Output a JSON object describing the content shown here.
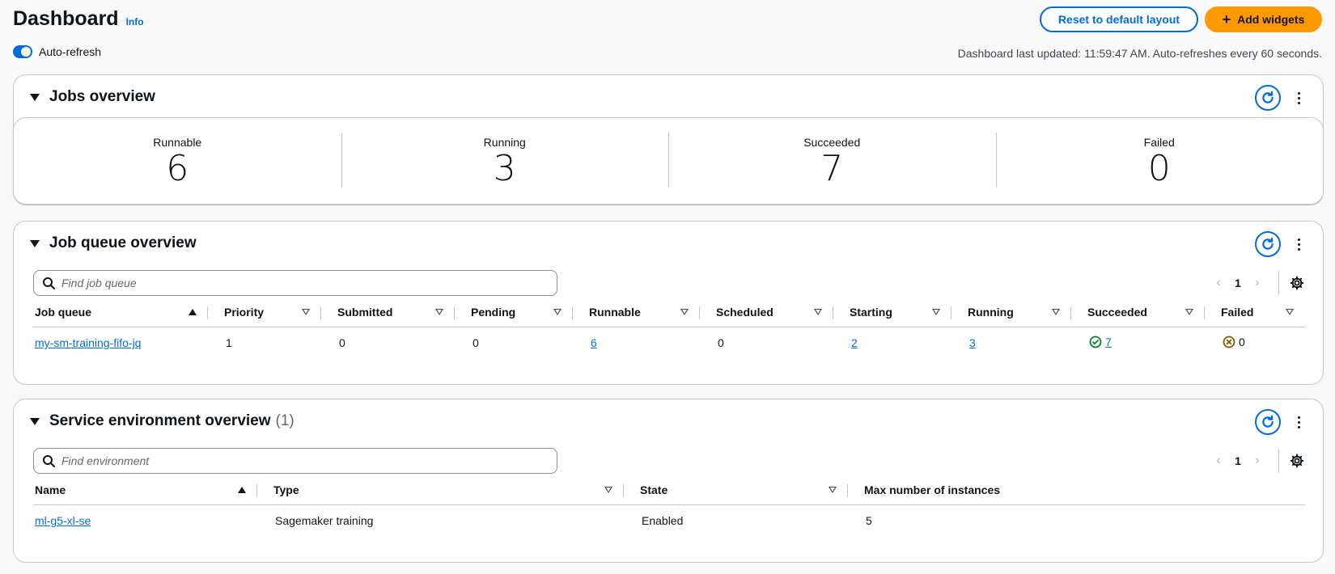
{
  "header": {
    "title": "Dashboard",
    "info_label": "Info",
    "reset_label": "Reset to default layout",
    "add_widgets_label": "Add widgets",
    "auto_refresh_label": "Auto-refresh",
    "auto_refresh_enabled": true,
    "last_updated": "Dashboard last updated: 11:59:47 AM. Auto-refreshes every 60 seconds."
  },
  "jobs_overview": {
    "title": "Jobs overview",
    "stats": [
      {
        "label": "Runnable",
        "value": "6"
      },
      {
        "label": "Running",
        "value": "3"
      },
      {
        "label": "Succeeded",
        "value": "7"
      },
      {
        "label": "Failed",
        "value": "0"
      }
    ]
  },
  "job_queue_overview": {
    "title": "Job queue overview",
    "search_placeholder": "Find job queue",
    "page": "1",
    "columns": [
      "Job queue",
      "Priority",
      "Submitted",
      "Pending",
      "Runnable",
      "Scheduled",
      "Starting",
      "Running",
      "Succeeded",
      "Failed"
    ],
    "rows": [
      {
        "job_queue": "my-sm-training-fifo-jq",
        "priority": "1",
        "submitted": "0",
        "pending": "0",
        "runnable": "6",
        "scheduled": "0",
        "starting": "2",
        "running": "3",
        "succeeded": "7",
        "failed": "0"
      }
    ]
  },
  "service_environment_overview": {
    "title": "Service environment overview",
    "count": "(1)",
    "search_placeholder": "Find environment",
    "page": "1",
    "columns": [
      "Name",
      "Type",
      "State",
      "Max number of instances"
    ],
    "rows": [
      {
        "name": "ml-g5-xl-se",
        "type": "Sagemaker training",
        "state": "Enabled",
        "max_instances": "5"
      }
    ]
  },
  "colors": {
    "accent": "#006ce0",
    "primary_button": "#ff9900",
    "success": "#00802f",
    "failed_icon": "#855900",
    "border": "#c6c6cd"
  },
  "icons": [
    "info-link",
    "plus-icon",
    "refresh-icon",
    "kebab-icon",
    "caret-down-icon",
    "search-icon",
    "chevron-left-icon",
    "chevron-right-icon",
    "gear-icon",
    "sort-ascending-icon",
    "sort-icon",
    "success-icon",
    "stopped-icon"
  ]
}
